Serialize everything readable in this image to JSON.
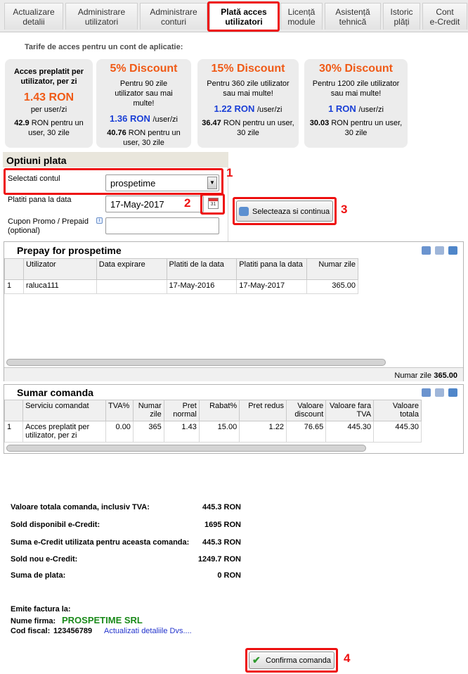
{
  "tabs": [
    {
      "label": "Actualizare\ndetalii",
      "active": false
    },
    {
      "label": "Administrare\nutilizatori",
      "active": false
    },
    {
      "label": "Administrare\nconturi",
      "active": false
    },
    {
      "label": "Plată acces\nutilizatori",
      "active": true
    },
    {
      "label": "Licență\nmodule",
      "active": false
    },
    {
      "label": "Asistență\ntehnică",
      "active": false
    },
    {
      "label": "Istoric\nplăți",
      "active": false
    },
    {
      "label": "Cont\ne-Credit",
      "active": false
    }
  ],
  "pricing": {
    "heading": "Tarife de acces pentru un cont de aplicatie:",
    "cards": [
      {
        "title": "Acces preplatit per utilizator, per zi",
        "price": "1.43 RON",
        "unit": "per user/zi",
        "sub_bold": "42.9",
        "sub": " RON pentru un user, 30 zile"
      },
      {
        "title": "5% Discount",
        "desc": "Pentru 90 zile utilizator sau mai multe!",
        "price": "1.36 RON",
        "unit": "/user/zi",
        "sub_bold": "40.76",
        "sub": " RON pentru un user, 30 zile"
      },
      {
        "title": "15% Discount",
        "desc": "Pentru 360 zile utilizator sau mai multe!",
        "price": "1.22 RON",
        "unit": "/user/zi",
        "sub_bold": "36.47",
        "sub": " RON pentru un user, 30 zile"
      },
      {
        "title": "30% Discount",
        "desc": "Pentru 1200 zile utilizator sau mai multe!",
        "price": "1 RON",
        "unit": "/user/zi",
        "sub_bold": "30.03",
        "sub": " RON pentru un user, 30 zile"
      }
    ]
  },
  "options": {
    "title": "Optiuni plata",
    "account_label": "Selectati contul",
    "account_value": "prospetime",
    "pay_until_label": "Platiti pana la data",
    "pay_until_value": "17-May-2017",
    "promo_label": "Cupon Promo / Prepaid (optional)",
    "promo_value": "",
    "select_button": "Selecteaza si continua",
    "calendar_day": "31"
  },
  "annotations": [
    "1",
    "2",
    "3",
    "4"
  ],
  "prepay": {
    "title": "Prepay for prospetime",
    "columns": [
      "",
      "Utilizator",
      "Data expirare",
      "Platiti de la data",
      "Platiti pana la data",
      "Numar zile"
    ],
    "rows": [
      [
        "1",
        "raluca111",
        "",
        "17-May-2016",
        "17-May-2017",
        "365.00"
      ]
    ],
    "footer_label": "Numar zile",
    "footer_value": "365.00"
  },
  "summary": {
    "title": "Sumar comanda",
    "columns": [
      "",
      "Serviciu comandat",
      "TVA%",
      "Numar zile",
      "Pret normal",
      "Rabat%",
      "Pret redus",
      "Valoare discount",
      "Valoare fara TVA",
      "Valoare totala"
    ],
    "rows": [
      [
        "1",
        "Acces preplatit per utilizator, per zi",
        "0.00",
        "365",
        "1.43",
        "15.00",
        "1.22",
        "76.65",
        "445.30",
        "445.30"
      ]
    ]
  },
  "totals": [
    {
      "label": "Valoare totala comanda, inclusiv TVA:",
      "value": "445.3 RON"
    },
    {
      "label": "Sold disponibil e-Credit:",
      "value": "1695 RON"
    },
    {
      "label": "Suma e-Credit utilizata pentru aceasta comanda:",
      "value": "445.3 RON"
    },
    {
      "label": "Sold nou e-Credit:",
      "value": "1249.7 RON"
    },
    {
      "label": "Suma de plata:",
      "value": "0 RON"
    }
  ],
  "invoice": {
    "heading": "Emite factura la:",
    "name_label": "Nume firma:",
    "name_value": "PROSPETIME SRL",
    "fiscal_label": "Cod fiscal:",
    "fiscal_value": "123456789",
    "update_link": "Actualizati detaliile Dvs...."
  },
  "confirm_button": "Confirma comanda",
  "colors": {
    "accent_orange": "#f05a16",
    "price_blue": "#1a3fd6",
    "annotation_red": "#e11111",
    "firm_green": "#1a8a1a"
  }
}
